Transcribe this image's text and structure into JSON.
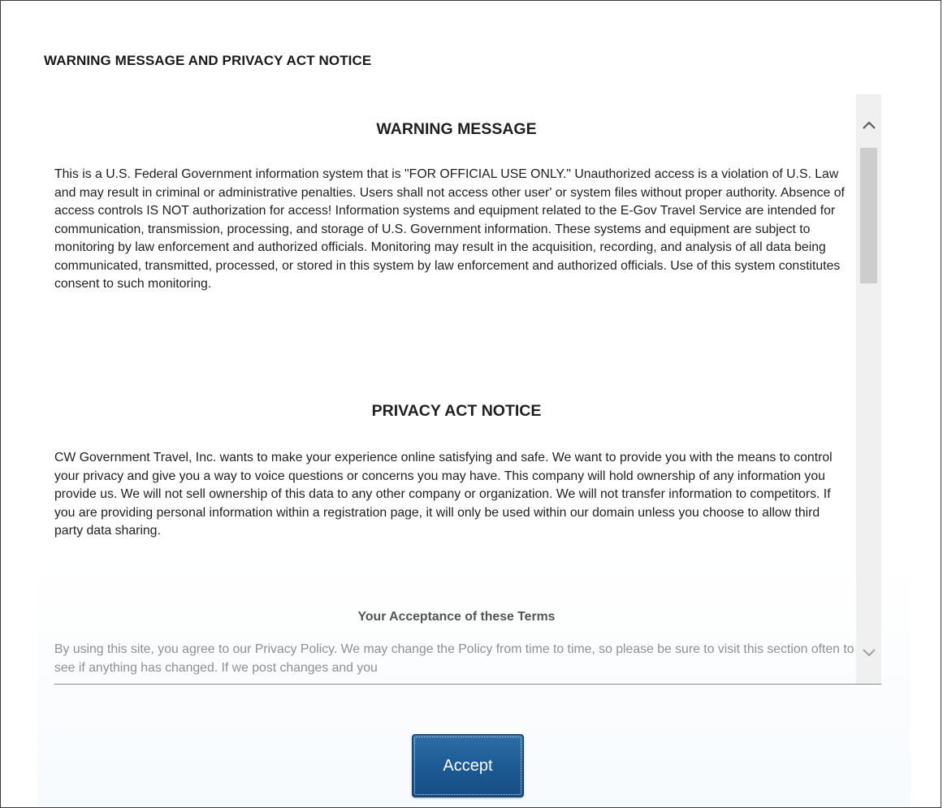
{
  "dialog": {
    "title": "WARNING MESSAGE AND PRIVACY ACT NOTICE"
  },
  "warning": {
    "heading": "WARNING MESSAGE",
    "body": "This is a U.S. Federal Government information system that is \"FOR OFFICIAL USE ONLY.\" Unauthorized access is a violation of U.S. Law and may result in criminal or administrative penalties. Users shall not access other user' or system files without proper authority. Absence of access controls IS NOT authorization for access! Information systems and equipment related to the E-Gov Travel Service are intended for communication, transmission, processing, and storage of U.S. Government information. These systems and equipment are subject to monitoring by law enforcement and authorized officials. Monitoring may result in the acquisition, recording, and analysis of all data being communicated, transmitted, processed, or stored in this system by law enforcement and authorized officials. Use of this system constitutes consent to such monitoring."
  },
  "privacy": {
    "heading": "PRIVACY ACT NOTICE",
    "body": "CW Government Travel, Inc. wants to make your experience online satisfying and safe. We want to provide you with the means to control your privacy and give you a way to voice questions or concerns you may have. This company will hold ownership of any information you provide us. We will not sell ownership of this data to any other company or organization. We will not transfer information to competitors. If you are providing personal information within a registration page, it will only be used within our domain unless you choose to allow third party data sharing."
  },
  "terms": {
    "heading": "Your Acceptance of these Terms",
    "body": "By using this site, you agree to our Privacy Policy. We may change the Policy from time to time, so please be sure to visit this section often to see if anything has changed. If we post changes and you"
  },
  "scrollbar": {
    "up_icon": "chevron-up-icon",
    "down_icon": "chevron-down-icon"
  },
  "actions": {
    "accept_label": "Accept"
  },
  "colors": {
    "accept_button": "#1d5a94",
    "text": "#1f1f1f",
    "faded_text": "#8f8f8f"
  }
}
